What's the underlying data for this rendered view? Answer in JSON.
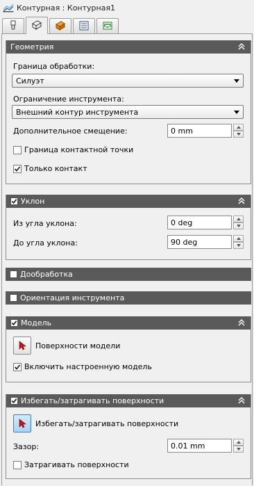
{
  "window": {
    "title": "Контурная : Контурная1"
  },
  "tabs": [
    {
      "icon": "tool-icon"
    },
    {
      "icon": "geometry-icon"
    },
    {
      "icon": "heights-icon"
    },
    {
      "icon": "passes-icon"
    },
    {
      "icon": "linking-icon"
    }
  ],
  "geometry": {
    "header": "Геометрия",
    "boundary_label": "Граница обработки:",
    "boundary_value": "Силуэт",
    "tool_limit_label": "Ограничение инструмента:",
    "tool_limit_value": "Внешний контур инструмента",
    "offset_label": "Дополнительное смещение:",
    "offset_value": "0 mm",
    "contact_boundary_label": "Граница контактной точки",
    "contact_boundary_checked": false,
    "contact_only_label": "Только контакт",
    "contact_only_checked": true
  },
  "slope": {
    "header": "Уклон",
    "enabled": true,
    "from_label": "Из угла уклона:",
    "from_value": "0 deg",
    "to_label": "До угла уклона:",
    "to_value": "90 deg"
  },
  "rest": {
    "header": "Дообработка",
    "enabled": false
  },
  "orientation": {
    "header": "Ориентация инструмента",
    "enabled": false
  },
  "model": {
    "header": "Модель",
    "enabled": true,
    "surfaces_label": "Поверхности модели",
    "include_stock_label": "Включить настроенную модель",
    "include_stock_checked": true
  },
  "avoid": {
    "header": "Избегать/затрагивать поверхности",
    "enabled": true,
    "surfaces_label": "Избегать/затрагивать поверхности",
    "clearance_label": "Зазор:",
    "clearance_value": "0.01 mm",
    "touch_label": "Затрагивать поверхности",
    "touch_checked": false
  },
  "colors": {
    "header_bg": "#5a5a5a",
    "header_text": "#ffffff",
    "accent_blue": "#3c7fb1"
  }
}
